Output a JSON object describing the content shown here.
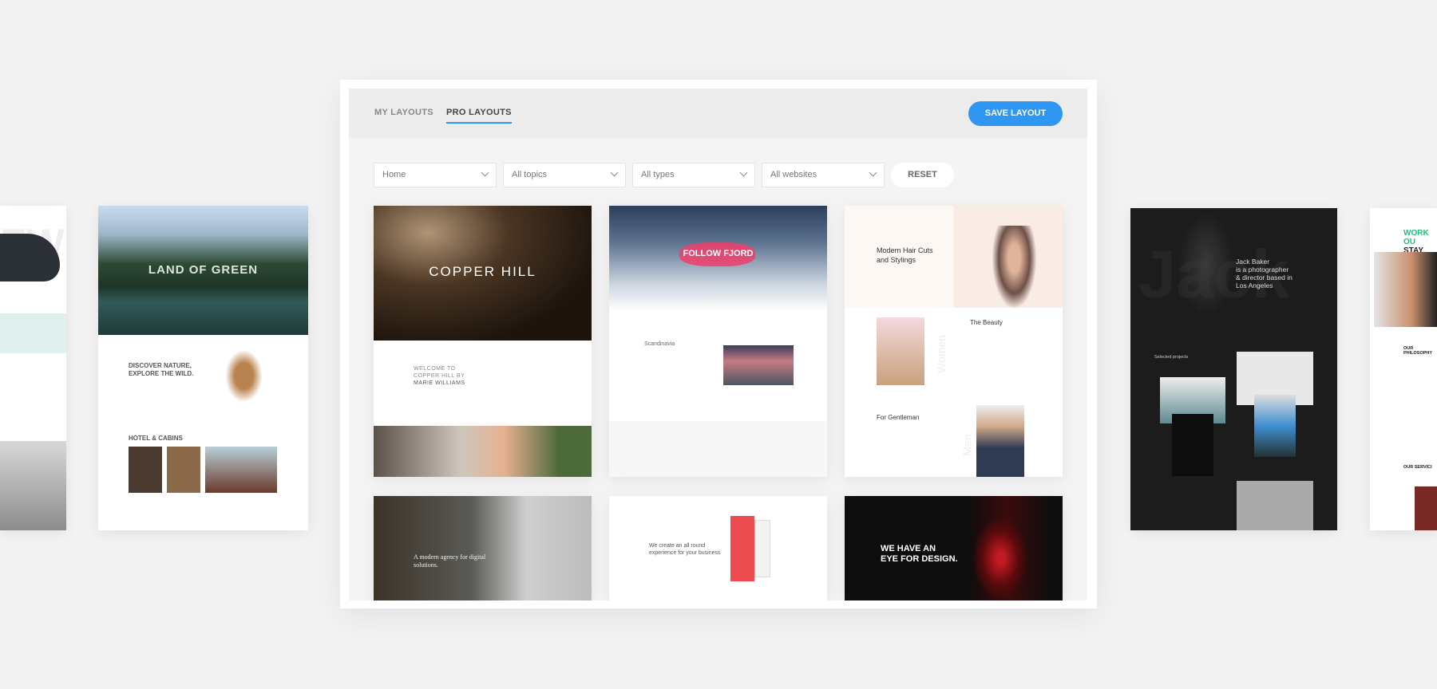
{
  "header": {
    "tabs": [
      {
        "label": "MY LAYOUTS",
        "active": false
      },
      {
        "label": "PRO LAYOUTS",
        "active": true
      }
    ],
    "save_label": "SAVE LAYOUT"
  },
  "filters": {
    "page": "Home",
    "topics": "All topics",
    "types": "All types",
    "websites": "All websites",
    "reset_label": "RESET"
  },
  "colors": {
    "accent": "#2f96f2",
    "panel_header": "#ececec",
    "panel_body": "#f4f4f4"
  },
  "layouts": [
    {
      "title": "COPPER HILL",
      "welcome": [
        "WELCOME TO",
        "COPPER HILL BY",
        "MARIE WILLIAMS"
      ]
    },
    {
      "title": "FOLLOW FJORD",
      "section": "Scandinavia"
    },
    {
      "title": [
        "Modern Hair Cuts",
        "and Stylings"
      ],
      "beauty": "The Beauty",
      "women": "Women",
      "gentleman": "For Gentleman",
      "men": "Men"
    },
    {
      "title": [
        "A modern agency for digital",
        "solutions."
      ]
    },
    {
      "title": [
        "We create an all round",
        "experience for your business"
      ]
    },
    {
      "title": [
        "WE HAVE AN",
        "EYE FOR DESIGN."
      ]
    }
  ],
  "side_layouts": {
    "nature": {
      "title": "LAND OF GREEN",
      "headline": [
        "DISCOVER NATURE,",
        "EXPLORE THE WILD."
      ],
      "section": "HOTEL & CABINS"
    },
    "furniture": {
      "title": "EW"
    },
    "photographer": {
      "title": "Jack",
      "bio": [
        "Jack Baker",
        "is a photographer",
        "& director based in",
        "Los Angeles"
      ],
      "projects": "Selected projects"
    },
    "fitness": {
      "title": [
        "WORK OU",
        "STAY STR"
      ],
      "philosophy": [
        "OUR",
        "PHILOSOPHY"
      ],
      "services": "OUR SERVICI"
    }
  }
}
